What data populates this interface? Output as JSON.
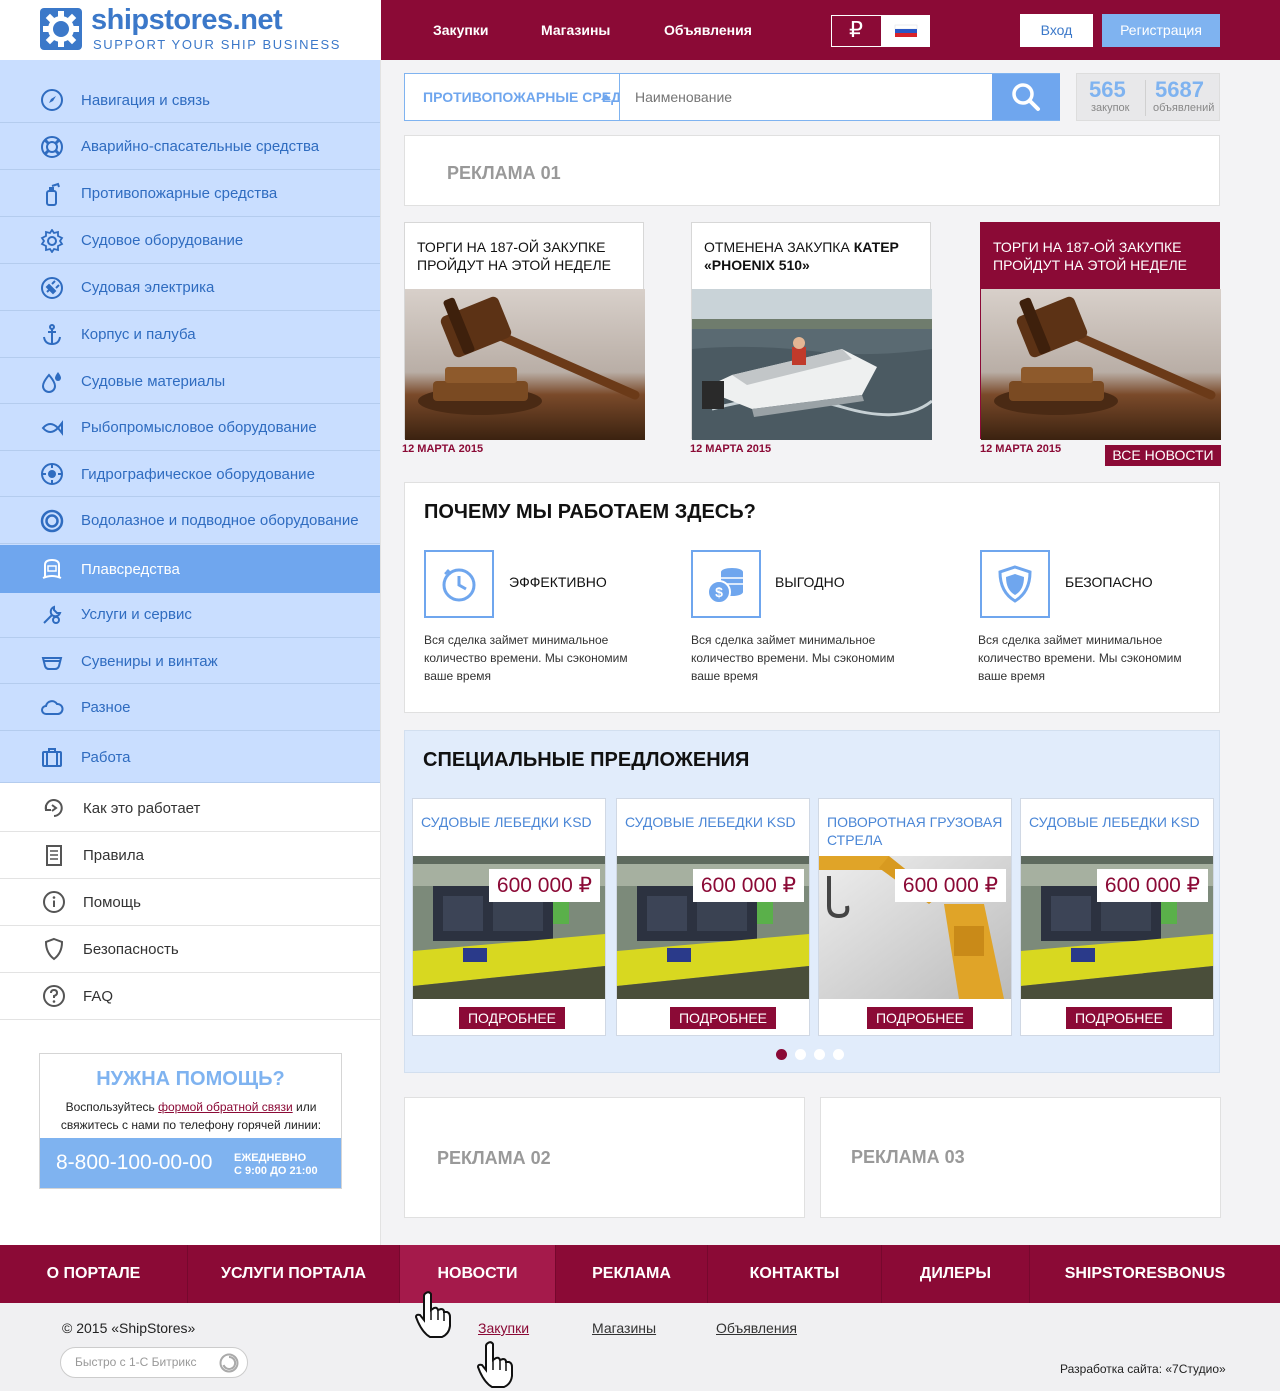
{
  "brand": {
    "name": "shipstores.net",
    "tagline": "SUPPORT YOUR SHIP BUSINESS",
    "accent": "#8b0a36",
    "blue": "#3b78c9",
    "light_blue": "#7fb3f0"
  },
  "topnav": [
    "Закупки",
    "Магазины",
    "Объявления"
  ],
  "currency": {
    "symbol": "₽",
    "flag": "russia-flag-icon"
  },
  "auth": {
    "login": "Вход",
    "register": "Регистрация"
  },
  "sidebar": {
    "categories": [
      {
        "label": "Навигация и связь",
        "icon": "compass-icon"
      },
      {
        "label": "Аварийно-спасательные средства",
        "icon": "lifebuoy-icon"
      },
      {
        "label": "Противопожарные средства",
        "icon": "extinguisher-icon"
      },
      {
        "label": "Судовое оборудование",
        "icon": "gear-icon"
      },
      {
        "label": "Судовая электрика",
        "icon": "plug-icon"
      },
      {
        "label": "Корпус и палуба",
        "icon": "anchor-icon"
      },
      {
        "label": "Судовые материалы",
        "icon": "drops-icon"
      },
      {
        "label": "Рыбопромысловое оборудование",
        "icon": "fish-icon"
      },
      {
        "label": "Гидрографическое оборудование",
        "icon": "sonar-icon"
      },
      {
        "label": "Водолазное и подводное оборудование",
        "icon": "porthole-icon"
      },
      {
        "label": "Плавсредства",
        "icon": "boat-icon",
        "active": true
      },
      {
        "label": "Услуги и сервис",
        "icon": "wrench-icon"
      },
      {
        "label": "Сувениры и винтаж",
        "icon": "cup-icon"
      },
      {
        "label": "Разное",
        "icon": "cloud-icon"
      },
      {
        "label": "Работа",
        "icon": "briefcase-icon"
      }
    ],
    "links": [
      {
        "label": "Как это работает",
        "icon": "cycle-icon"
      },
      {
        "label": "Правила",
        "icon": "document-icon"
      },
      {
        "label": "Помощь",
        "icon": "info-icon"
      },
      {
        "label": "Безопасность",
        "icon": "shield-icon"
      },
      {
        "label": "FAQ",
        "icon": "question-icon"
      }
    ]
  },
  "help": {
    "title": "НУЖНА ПОМОЩЬ?",
    "text_before": "Воспользуйтесь ",
    "link": "формой обратной связи",
    "text_after": " или свяжитесь с нами по телефону горячей линии:",
    "phone": "8-800-100-00-00",
    "hours_line1": "ЕЖЕДНЕВНО",
    "hours_line2": "С 9:00 ДО 21:00"
  },
  "search": {
    "category": "ПРОТИВОПОЖАРНЫЕ СРЕДСТВА",
    "placeholder": "Наименование"
  },
  "stats": [
    {
      "value": "565",
      "label": "закупок"
    },
    {
      "value": "5687",
      "label": "объявлений"
    }
  ],
  "ads": {
    "ad1": "РЕКЛАМА 01",
    "ad2": "РЕКЛАМА 02",
    "ad3": "РЕКЛАМА 03"
  },
  "news": [
    {
      "title": "ТОРГИ НА 187-ОЙ ЗАКУПКЕ ПРОЙДУТ НА ЭТОЙ НЕДЕЛЕ",
      "date": "12 МАРТА 2015",
      "image": "gavel-image"
    },
    {
      "title_plain": "ОТМЕНЕНА ЗАКУПКА ",
      "title_bold": "КАТЕР «PHOENIX 510»",
      "date": "12 МАРТА 2015",
      "image": "motorboat-image"
    },
    {
      "title": "ТОРГИ НА 187-ОЙ ЗАКУПКЕ ПРОЙДУТ НА ЭТОЙ НЕДЕЛЕ",
      "date": "12 МАРТА 2015",
      "image": "gavel-image",
      "highlighted": true
    }
  ],
  "all_news": "ВСЕ НОВОСТИ",
  "why": {
    "title": "ПОЧЕМУ МЫ РАБОТАЕМ ЗДЕСЬ?",
    "items": [
      {
        "label": "ЭФФЕКТИВНО",
        "icon": "clock-icon",
        "text": "Вся сделка займет минимальное количество времени. Мы сэкономим ваше время"
      },
      {
        "label": "ВЫГОДНО",
        "icon": "coins-icon",
        "text": "Вся сделка займет минимальное количество времени. Мы сэкономим ваше время"
      },
      {
        "label": "БЕЗОПАСНО",
        "icon": "shield-icon",
        "text": "Вся сделка займет минимальное количество времени. Мы сэкономим ваше время"
      }
    ]
  },
  "special": {
    "title": "СПЕЦИАЛЬНЫЕ ПРЕДЛОЖЕНИЯ",
    "products": [
      {
        "title": "СУДОВЫЕ ЛЕБЕДКИ KSD",
        "price": "600 000 ₽",
        "more": "ПОДРОБНЕЕ",
        "image": "winch-image"
      },
      {
        "title": "СУДОВЫЕ ЛЕБЕДКИ KSD",
        "price": "600 000 ₽",
        "more": "ПОДРОБНЕЕ",
        "image": "winch-image"
      },
      {
        "title": "ПОВОРОТНАЯ ГРУЗОВАЯ СТРЕЛА",
        "price": "600 000 ₽",
        "more": "ПОДРОБНЕЕ",
        "image": "crane-image"
      },
      {
        "title": "СУДОВЫЕ ЛЕБЕДКИ KSD",
        "price": "600 000 ₽",
        "more": "ПОДРОБНЕЕ",
        "image": "winch-image"
      }
    ],
    "pages": 4,
    "current_page": 1
  },
  "footer": {
    "nav": [
      "О ПОРТАЛЕ",
      "УСЛУГИ ПОРТАЛА",
      "НОВОСТИ",
      "РЕКЛАМА",
      "КОНТАКТЫ",
      "ДИЛЕРЫ",
      "SHIPSTORESBONUS"
    ],
    "active": "НОВОСТИ",
    "copyright": "© 2015 «ShipStores»",
    "links": [
      "Закупки",
      "Магазины",
      "Объявления"
    ],
    "bitrix": "Быстро с 1-С Битрикс",
    "developer": "Разработка сайта: «7Студио»"
  }
}
